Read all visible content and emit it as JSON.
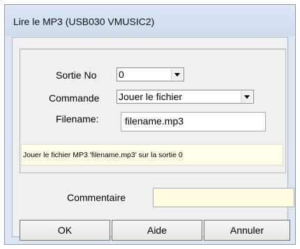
{
  "window": {
    "title": "Lire le MP3 (USB030 VMUSIC2)"
  },
  "form": {
    "output_label": "Sortie No",
    "output_value": "0",
    "command_label": "Commande",
    "command_value": "Jouer le fichier",
    "filename_label": "Filename:",
    "filename_value": "filename.mp3",
    "description": "Jouer le fichier MP3 'filename.mp3' sur la sortie 0",
    "comment_label": "Commentaire",
    "comment_value": ""
  },
  "buttons": {
    "ok": "OK",
    "help": "Aide",
    "cancel": "Annuler"
  }
}
